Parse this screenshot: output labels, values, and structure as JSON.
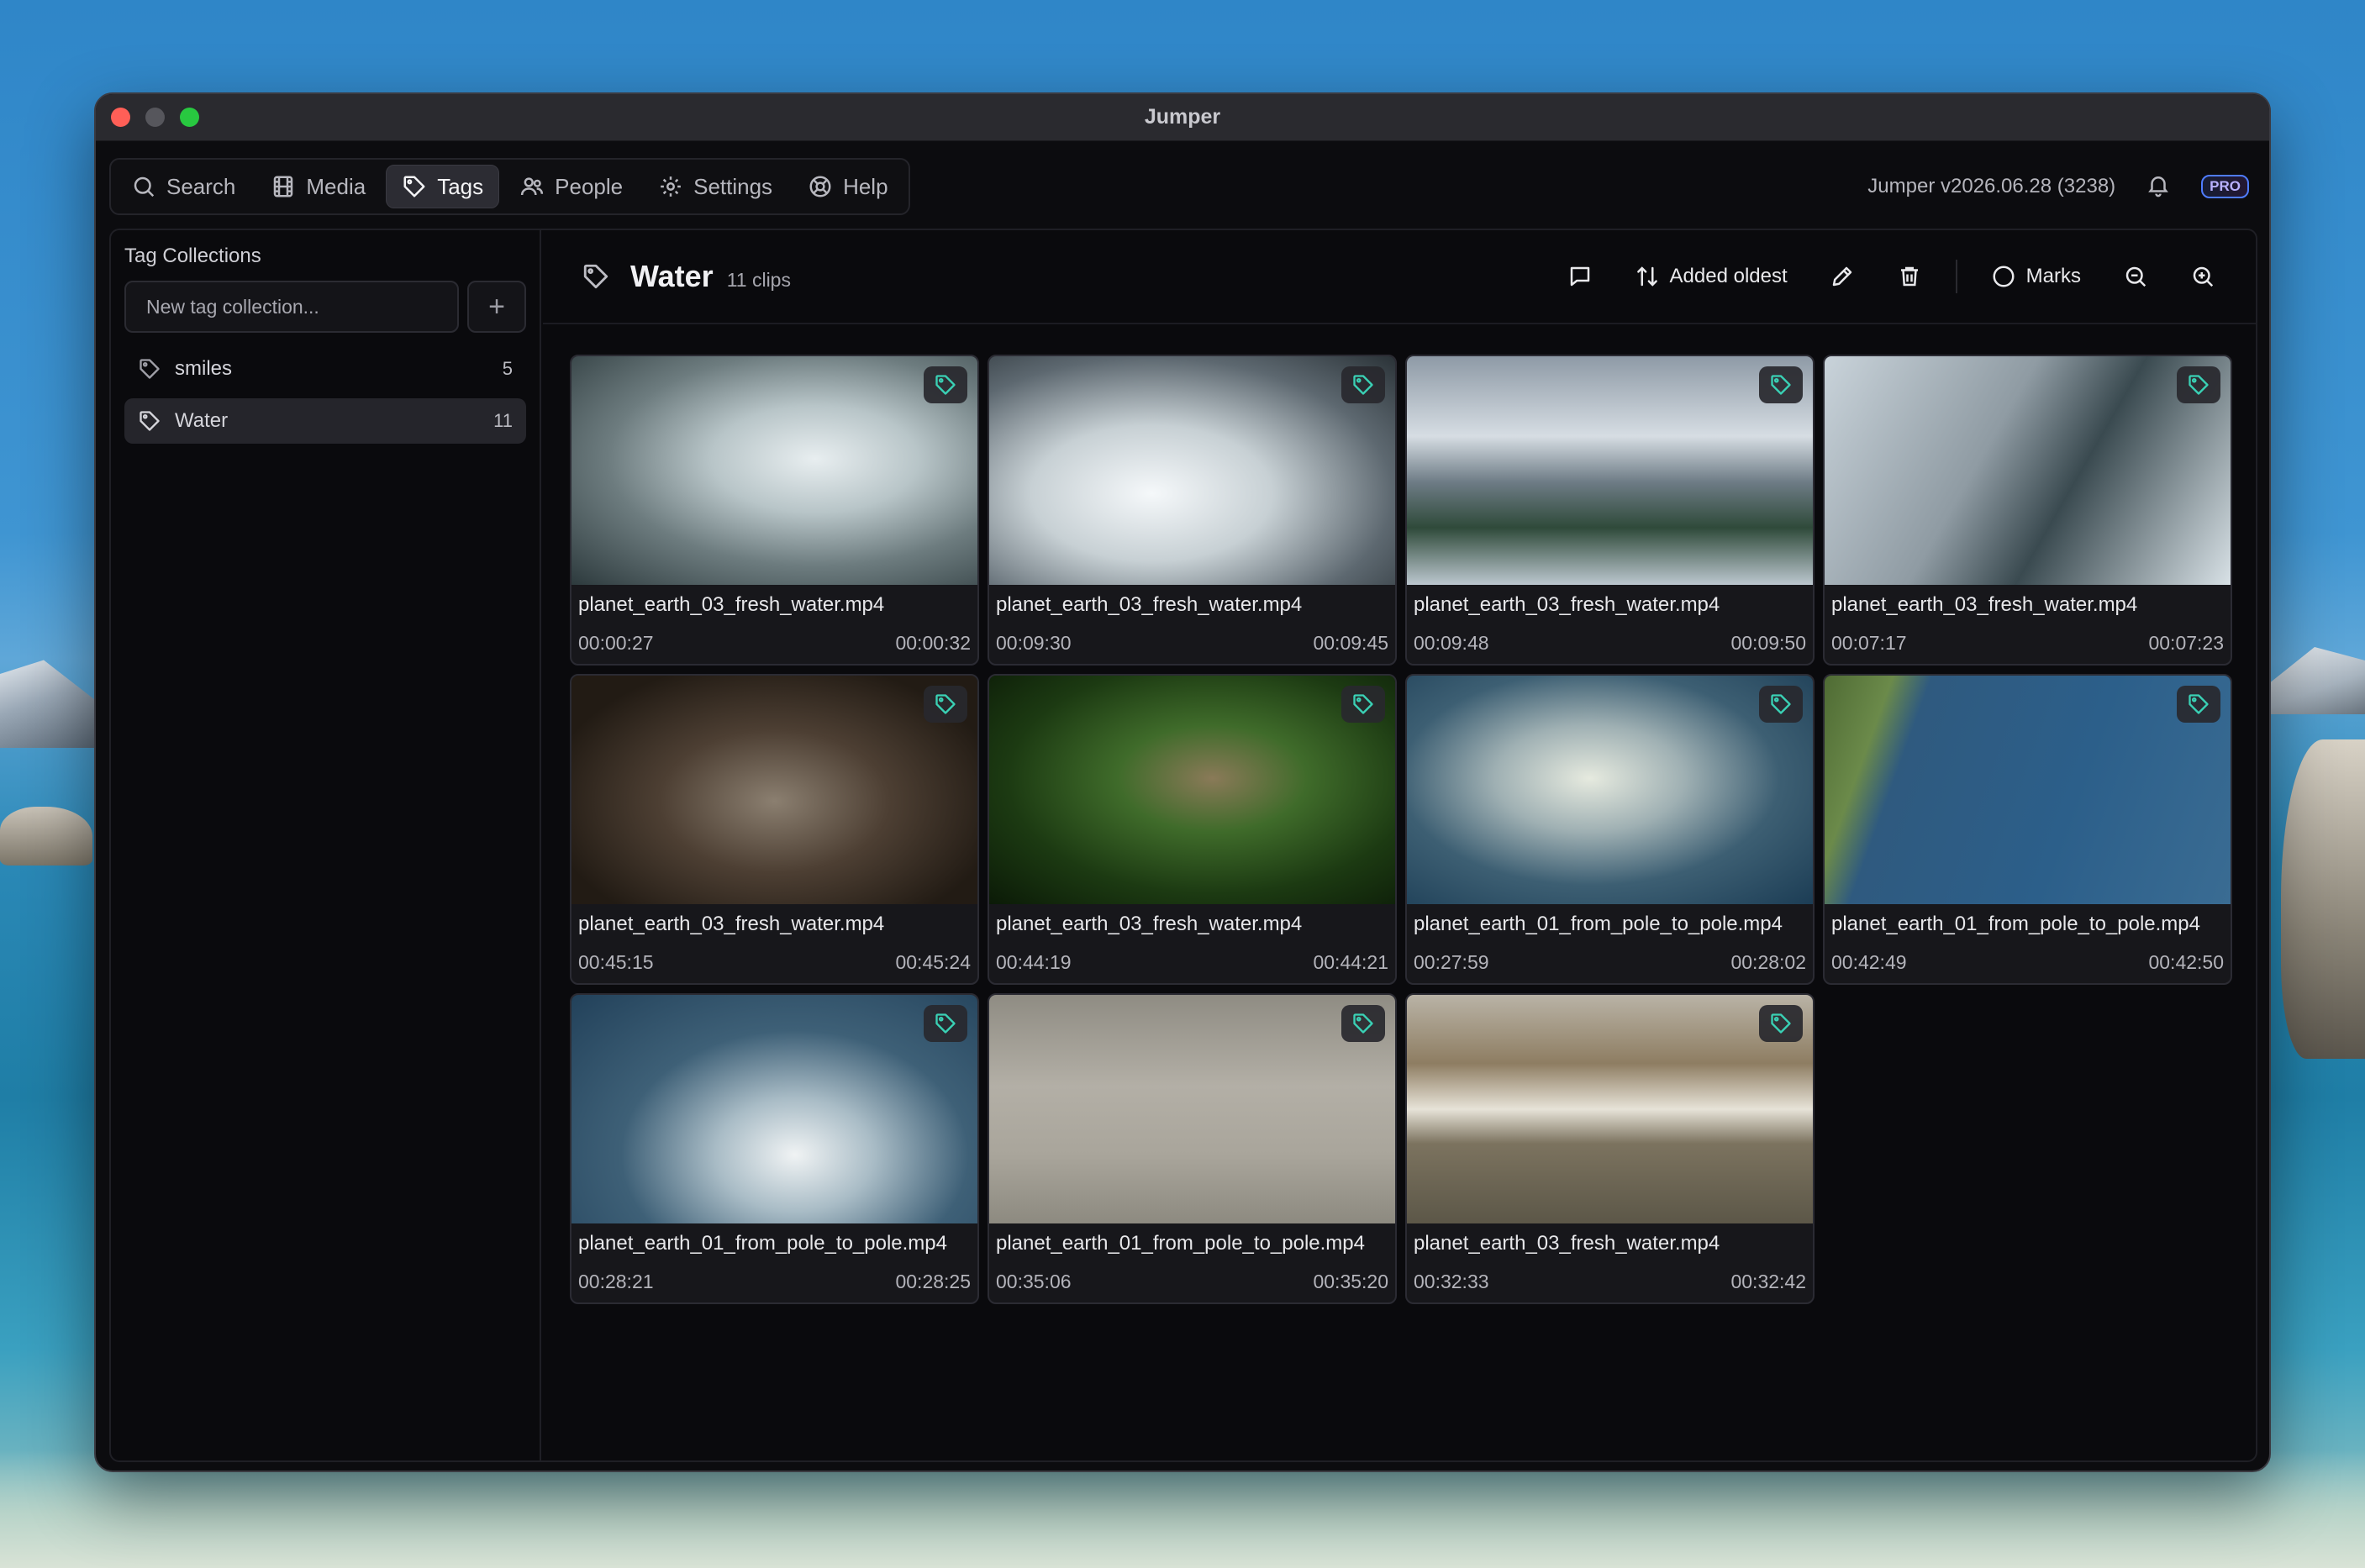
{
  "window": {
    "title": "Jumper"
  },
  "nav": {
    "items": [
      {
        "label": "Search",
        "icon": "search-icon"
      },
      {
        "label": "Media",
        "icon": "film-icon"
      },
      {
        "label": "Tags",
        "icon": "tag-icon",
        "active": true
      },
      {
        "label": "People",
        "icon": "people-icon"
      },
      {
        "label": "Settings",
        "icon": "gear-icon"
      },
      {
        "label": "Help",
        "icon": "lifebuoy-icon"
      }
    ],
    "version": "Jumper v2026.06.28 (3238)",
    "badge": "PRO"
  },
  "sidebar": {
    "title": "Tag Collections",
    "new_placeholder": "New tag collection...",
    "add_label": "+",
    "items": [
      {
        "label": "smiles",
        "count": "5"
      },
      {
        "label": "Water",
        "count": "11",
        "active": true
      }
    ]
  },
  "toolbar": {
    "title": "Water",
    "subtitle": "11 clips",
    "sort_label": "Added oldest",
    "marks_label": "Marks"
  },
  "colors": {
    "accent": "#3ad1b5",
    "pro_border": "#4f7cff"
  },
  "clips": [
    {
      "file": "planet_earth_03_fresh_water.mp4",
      "start": "00:00:27",
      "end": "00:00:32"
    },
    {
      "file": "planet_earth_03_fresh_water.mp4",
      "start": "00:09:30",
      "end": "00:09:45"
    },
    {
      "file": "planet_earth_03_fresh_water.mp4",
      "start": "00:09:48",
      "end": "00:09:50"
    },
    {
      "file": "planet_earth_03_fresh_water.mp4",
      "start": "00:07:17",
      "end": "00:07:23"
    },
    {
      "file": "planet_earth_03_fresh_water.mp4",
      "start": "00:45:15",
      "end": "00:45:24"
    },
    {
      "file": "planet_earth_03_fresh_water.mp4",
      "start": "00:44:19",
      "end": "00:44:21"
    },
    {
      "file": "planet_earth_01_from_pole_to_pole.mp4",
      "start": "00:27:59",
      "end": "00:28:02"
    },
    {
      "file": "planet_earth_01_from_pole_to_pole.mp4",
      "start": "00:42:49",
      "end": "00:42:50"
    },
    {
      "file": "planet_earth_01_from_pole_to_pole.mp4",
      "start": "00:28:21",
      "end": "00:28:25"
    },
    {
      "file": "planet_earth_01_from_pole_to_pole.mp4",
      "start": "00:35:06",
      "end": "00:35:20"
    },
    {
      "file": "planet_earth_03_fresh_water.mp4",
      "start": "00:32:33",
      "end": "00:32:42"
    }
  ]
}
